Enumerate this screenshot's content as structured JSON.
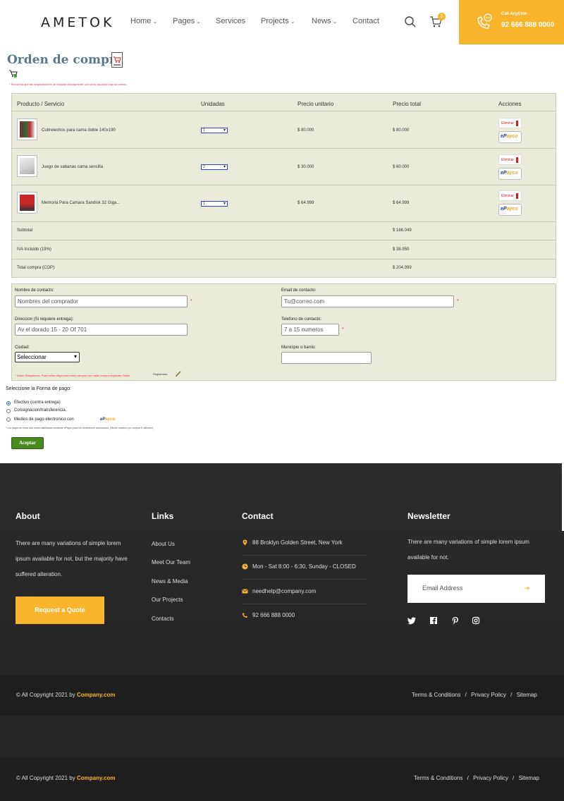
{
  "header": {
    "logo": "AMETOK",
    "nav": [
      {
        "label": "Home",
        "dropdown": true
      },
      {
        "label": "Pages",
        "dropdown": true
      },
      {
        "label": "Services",
        "dropdown": false
      },
      {
        "label": "Projects",
        "dropdown": true
      },
      {
        "label": "News",
        "dropdown": true
      },
      {
        "label": "Contact",
        "dropdown": false
      }
    ],
    "cart_count": "0",
    "call_label": "Call Anytime",
    "call_number": "92 666 888 0000"
  },
  "order": {
    "title": "Orden de compra",
    "top_note": "* Recuerda que las negociaciones se realizan directamente con otros usuarios bajo su criterio.",
    "columns": [
      "Producto / Servicio",
      "Unidadas",
      "Precio unitario",
      "Precio total",
      "Acciones"
    ],
    "items": [
      {
        "name": "Cubrelechos para cama doble 140x190",
        "qty": "1",
        "unit_price": "$ 80.000",
        "total_price": "$ 80.000"
      },
      {
        "name": "Juego de sabanas cama sencilla",
        "qty": "2",
        "unit_price": "$ 30.000",
        "total_price": "$ 60.000"
      },
      {
        "name": "Memoria Para Camara Sandisk 32 Giga...",
        "qty": "1",
        "unit_price": "$ 64.999",
        "total_price": "$ 64.999"
      }
    ],
    "delete_label": "Eliminar",
    "epayco_brand": [
      "eP",
      "ayco"
    ],
    "summary": [
      {
        "label": "Subtotal",
        "value": "$ 166.049"
      },
      {
        "label": "IVA Incluido (19%)",
        "value": "$ 38.950"
      },
      {
        "label": "Total compra (COP):",
        "value": "$ 204.999"
      }
    ]
  },
  "form": {
    "contact_name_label": "Nombre de contacto:",
    "contact_name_value": "Nombres del comprador",
    "email_label": "Email de contacto:",
    "email_value": "Tu@correo.com",
    "address_label": "Direccion (Si requiere entrega):",
    "address_value": "Av el dorado 15 - 20 Of 701",
    "phone_label": "Telefono de contacto:",
    "phone_value": "7 a 15 numeros",
    "city_label": "Ciudad:",
    "city_value": "Seleccionar",
    "district_label": "Municipio o barrio:",
    "district_value": "",
    "required_mark": "*",
    "note": "* Datos Obligatorios. Para evitar diligenciar estos campos con cada compra registrate Gratis.",
    "note_link": "Registrarse"
  },
  "payment": {
    "title": "Seleccione la Forma de pago:",
    "options": [
      {
        "label": "Efectivo (contra entrega)",
        "selected": true
      },
      {
        "label": "Consignacion/transferencia.",
        "selected": false
      },
      {
        "label": "Medios de pago electronico con",
        "selected": false
      }
    ],
    "note": "* Los pagos en linea solo estan habilitados mediante ePayco para los vendedores autorizados. (Monto maximo por compra 5 millones)",
    "accept_label": "Aceptar"
  },
  "footer": {
    "about_title": "About",
    "about_text": "There are many variations of simple lorem ipsum available for not, but the majority have suffered alteration.",
    "quote_button": "Request a Quote",
    "links_title": "Links",
    "links": [
      "About Us",
      "Meet Our Team",
      "News & Media",
      "Our Projects",
      "Contacts"
    ],
    "contact_title": "Contact",
    "contact": [
      {
        "icon": "map-pin-icon",
        "text": "88 Broklyn Golden Street, New York"
      },
      {
        "icon": "clock-icon",
        "text": "Mon - Sat 8:00 - 6:30, Sunday - CLOSED"
      },
      {
        "icon": "envelope-icon",
        "text": "needhelp@company.com"
      },
      {
        "icon": "phone-icon",
        "text": "92 666 888 0000"
      }
    ],
    "newsletter_title": "Newsletter",
    "newsletter_text": "There are many variations of simple lorem ipsum available for not.",
    "email_placeholder": "Email Address",
    "social": [
      "twitter-icon",
      "facebook-icon",
      "pinterest-icon",
      "instagram-icon"
    ],
    "copyright_prefix": "© All Copyright 2021 by ",
    "copyright_brand": "Company.com",
    "legal": [
      "Terms & Conditions",
      "/",
      "Privacy Policy",
      "/",
      "Sitemap"
    ]
  },
  "colors": {
    "accent": "#f8b42c",
    "footer_bg": "#242424",
    "panel_bg": "#ebebdc",
    "accept_green": "#4a8b1f"
  }
}
